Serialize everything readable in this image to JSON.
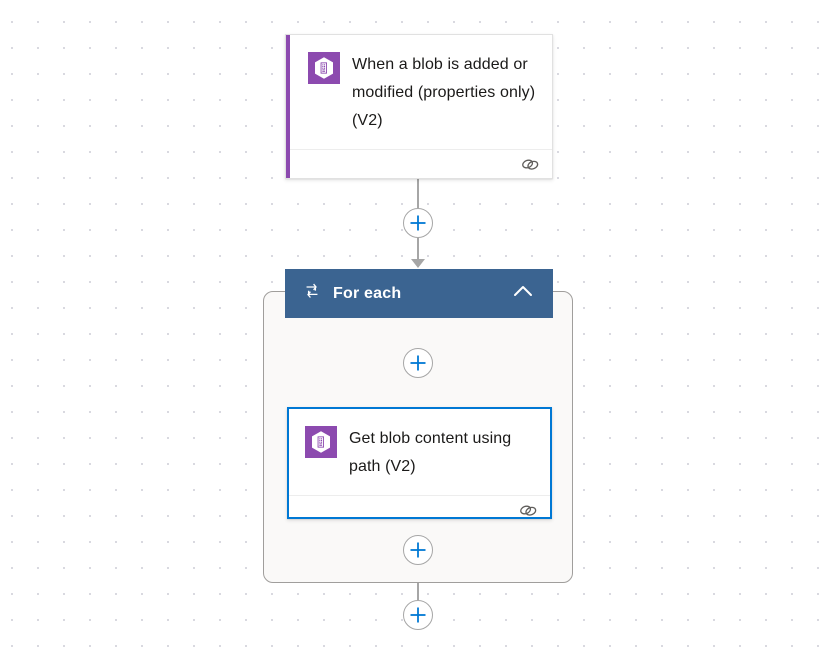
{
  "canvas": {
    "background": "#ffffff",
    "dot_color": "#d6d6de"
  },
  "colors": {
    "connector_accent": "#8c4aaf",
    "scope_header": "#3b6491",
    "selection": "#0078d4",
    "plus_glyph": "#0078d4",
    "connector_line": "#a6a6a6",
    "card_text": "#1b1a19"
  },
  "nodes": {
    "trigger": {
      "title": "When a blob is added or modified (properties only) (V2)",
      "icon": "azure-blob-storage-icon",
      "footer_icon": "link-icon",
      "selected": false
    },
    "scope": {
      "title": "For each",
      "icon": "loop-icon",
      "collapse_icon": "chevron-up-icon",
      "expanded": true
    },
    "action": {
      "title": "Get blob content using path (V2)",
      "icon": "azure-blob-storage-icon",
      "footer_icon": "link-icon",
      "selected": true
    }
  },
  "add_buttons": [
    {
      "name": "add-step-after-trigger",
      "label": "+"
    },
    {
      "name": "add-step-inside-foreach-top",
      "label": "+"
    },
    {
      "name": "add-step-inside-foreach-bottom",
      "label": "+"
    },
    {
      "name": "add-step-after-foreach",
      "label": "+"
    }
  ]
}
